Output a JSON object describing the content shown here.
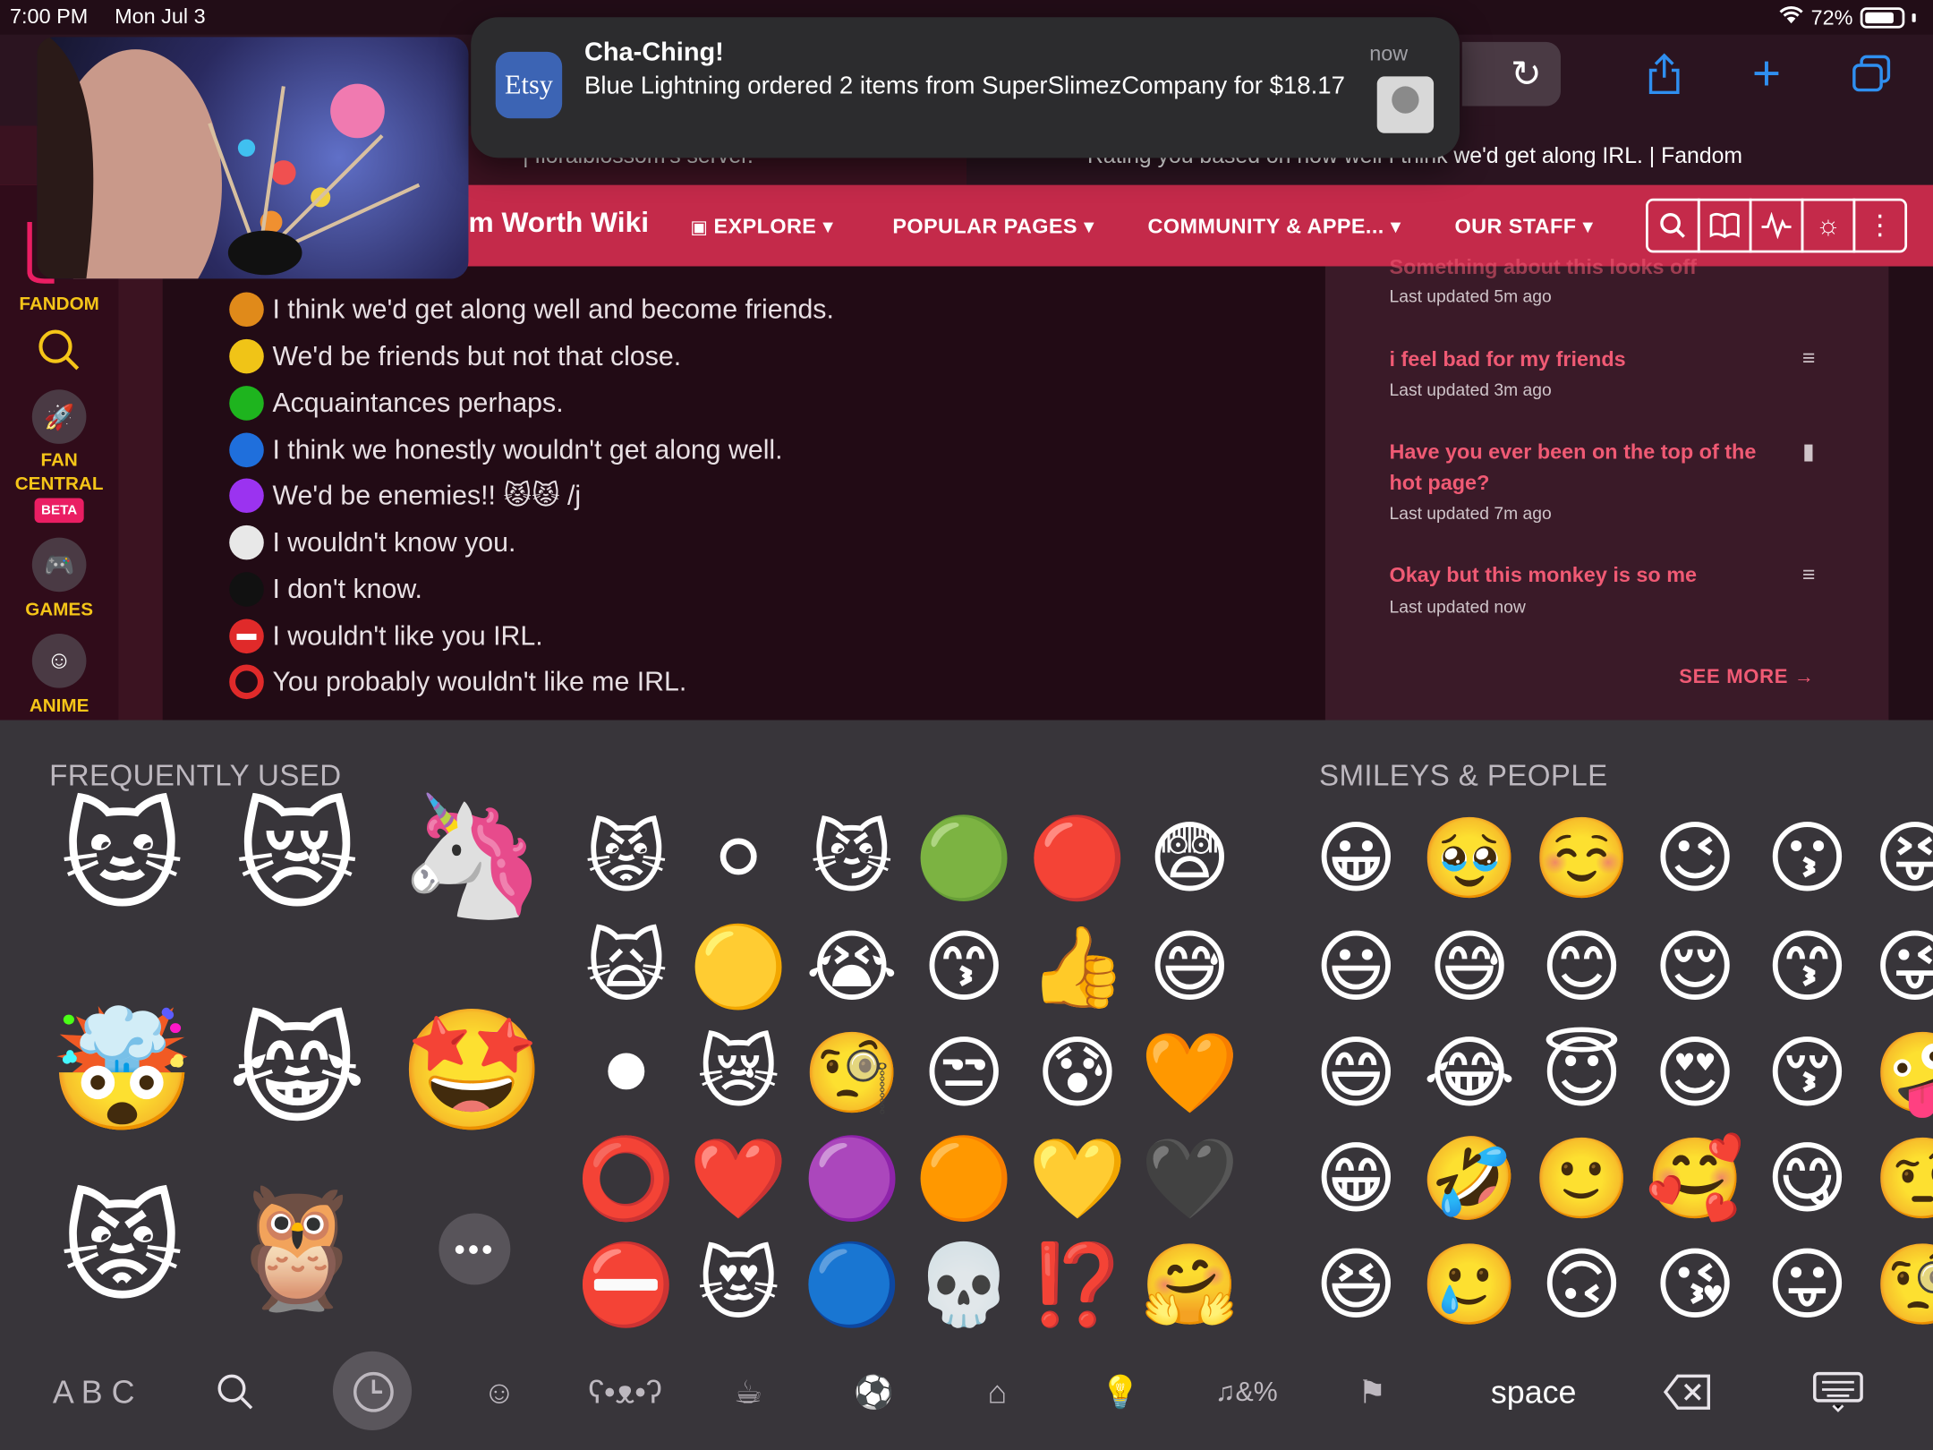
{
  "status_bar": {
    "time": "7:00 PM",
    "date": "Mon Jul 3",
    "battery": "72%"
  },
  "tabs": [
    {
      "label": "| floralblossom's server."
    },
    {
      "label": "Rating you based on how well I think we'd get along IRL. | Fandom"
    }
  ],
  "notification": {
    "app": "Etsy",
    "title": "Cha-Ching!",
    "body": "Blue Lightning ordered 2 items from SuperSlimezCompany for $18.17",
    "time": "now"
  },
  "fandom_nav": {
    "wiki_name": "m Worth Wiki",
    "items": [
      "EXPLORE",
      "POPULAR PAGES",
      "COMMUNITY & APPE...",
      "OUR STAFF"
    ]
  },
  "rail": {
    "fandom": "FANDOM",
    "fan_central": "FAN CENTRAL",
    "beta": "BETA",
    "games": "GAMES",
    "anime": "ANIME"
  },
  "legend": [
    {
      "text": "I think we'd get along well and become friends.",
      "color": "#e08a1a"
    },
    {
      "text": "We'd be friends but not that close.",
      "color": "#f0c417"
    },
    {
      "text": "Acquaintances perhaps.",
      "color": "#1eb41e"
    },
    {
      "text": "I think we honestly wouldn't get along well.",
      "color": "#1f6fdc"
    },
    {
      "text": "We'd be enemies!! 😾😾 /j",
      "color": "#9b33f0"
    },
    {
      "text": "I wouldn't know you.",
      "color": "#e8e8e8"
    },
    {
      "text": "I don't know.",
      "color": "#111111"
    },
    {
      "text": "I wouldn't like you IRL.",
      "color": "#e02a2a"
    },
    {
      "text": "You probably wouldn't like me IRL.",
      "color": "#e02a2a"
    }
  ],
  "side_panel": {
    "items": [
      {
        "title": "Something about this looks off",
        "sub": "Last updated 5m ago"
      },
      {
        "title": "i feel bad for my friends",
        "sub": "Last updated 3m ago"
      },
      {
        "title": "Have you ever been on the top of the hot page?",
        "sub": "Last updated 7m ago"
      },
      {
        "title": "Okay but this monkey is so me",
        "sub": "Last updated now"
      }
    ],
    "see_more": "SEE MORE"
  },
  "keyboard": {
    "frequent_heading": "FREQUENTLY USED",
    "smileys_heading": "SMILEYS & PEOPLE",
    "memoji": [
      "🐱",
      "😿",
      "🦄",
      "🤯",
      "😹",
      "🤩",
      "😾",
      "🦉"
    ],
    "frequent": [
      [
        "😾",
        "⚪",
        "😼",
        "🟢",
        "🔴",
        "😨"
      ],
      [
        "🙀",
        "🟡",
        "😭",
        "😙",
        "👍",
        "😅"
      ],
      [
        "⚫",
        "😿",
        "🧐",
        "😒",
        "😰",
        "🧡"
      ],
      [
        "⭕",
        "❤️",
        "🟣",
        "🟠",
        "💛",
        "🖤"
      ],
      [
        "⛔",
        "😻",
        "🔵",
        "💀",
        "⁉️",
        "🤗"
      ]
    ],
    "smileys": [
      [
        "😀",
        "🥹",
        "☺️",
        "😉",
        "😗",
        "😝"
      ],
      [
        "😃",
        "😅",
        "😊",
        "😌",
        "😙",
        "😜"
      ],
      [
        "😄",
        "😂",
        "😇",
        "😍",
        "😚",
        "🤪"
      ],
      [
        "😁",
        "🤣",
        "🙂",
        "🥰",
        "😋",
        "🤨"
      ],
      [
        "😆",
        "🥲",
        "🙃",
        "😘",
        "😛",
        "🧐"
      ]
    ],
    "abc": "A B C",
    "space": "space"
  },
  "colors": {
    "fandom_red": "#c42a4a",
    "link_pink": "#f05a74",
    "rail_yellow": "#f5c518",
    "ios_blue": "#2f8ff0"
  }
}
